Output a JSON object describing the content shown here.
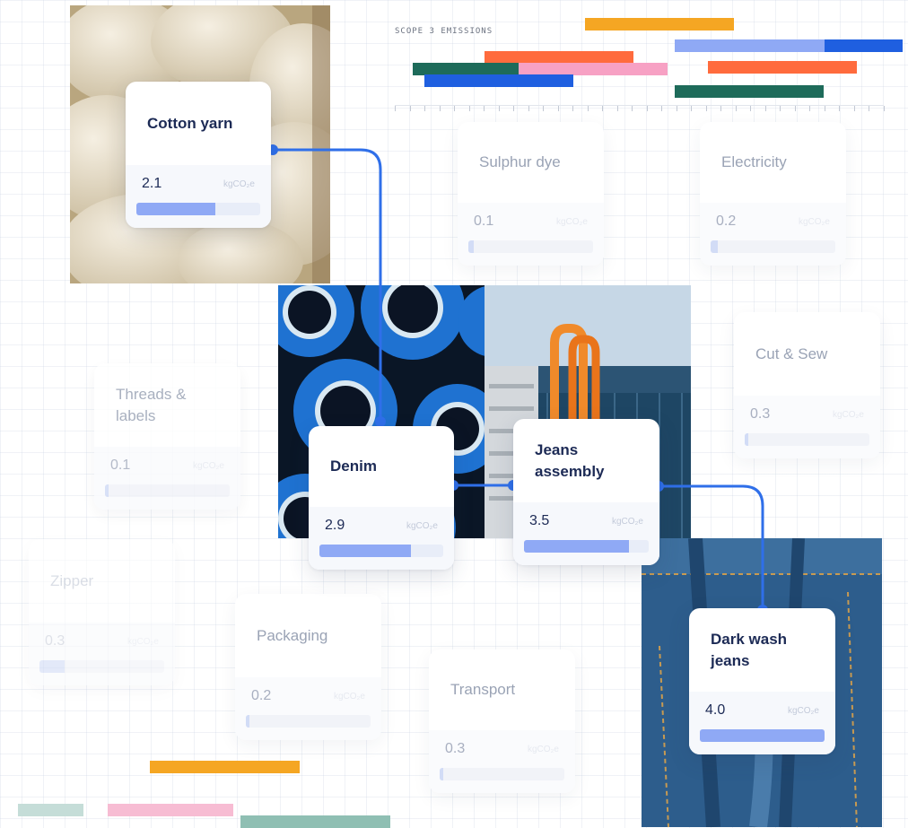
{
  "emissions": {
    "title": "SCOPE 3 EMISSIONS",
    "bars": [
      {
        "color": "#f5a623"
      },
      {
        "color": "#8fa9f5"
      },
      {
        "color": "#1f5fe0"
      },
      {
        "color": "#ff6b3d"
      },
      {
        "color": "#f7a1c4"
      },
      {
        "color": "#1e6b5a"
      },
      {
        "color": "#1f5fe0"
      },
      {
        "color": "#ff6b3d"
      },
      {
        "color": "#1e6b5a"
      }
    ]
  },
  "unit_label": "kgCO₂e",
  "nodes": {
    "cotton_yarn": {
      "title": "Cotton yarn",
      "value": "2.1",
      "progress": 0.64
    },
    "sulphur_dye": {
      "title": "Sulphur dye",
      "value": "0.1",
      "progress": 0.04
    },
    "electricity": {
      "title": "Electricity",
      "value": "0.2",
      "progress": 0.06
    },
    "cut_sew": {
      "title": "Cut & Sew",
      "value": "0.3",
      "progress": 0.03
    },
    "threads_labels": {
      "title": "Threads & labels",
      "value": "0.1",
      "progress": 0.03
    },
    "denim": {
      "title": "Denim",
      "value": "2.9",
      "progress": 0.74
    },
    "jeans_assembly": {
      "title": "Jeans assembly",
      "value": "3.5",
      "progress": 0.84
    },
    "zipper": {
      "title": "Zipper",
      "value": "0.3",
      "progress": 0.2
    },
    "packaging": {
      "title": "Packaging",
      "value": "0.2",
      "progress": 0.03
    },
    "transport": {
      "title": "Transport",
      "value": "0.3",
      "progress": 0.03
    },
    "dark_wash_jeans": {
      "title": "Dark wash jeans",
      "value": "4.0",
      "progress": 1.0
    }
  },
  "colors": {
    "accent": "#2f6fe9",
    "progress_fill": "#8fa9f5",
    "title_text": "#1c2a55"
  },
  "decor_bars": [
    {
      "color": "#f5a623"
    },
    {
      "color": "#c5ddd8"
    },
    {
      "color": "#f7bcd3"
    },
    {
      "color": "#8fbfb3"
    }
  ]
}
